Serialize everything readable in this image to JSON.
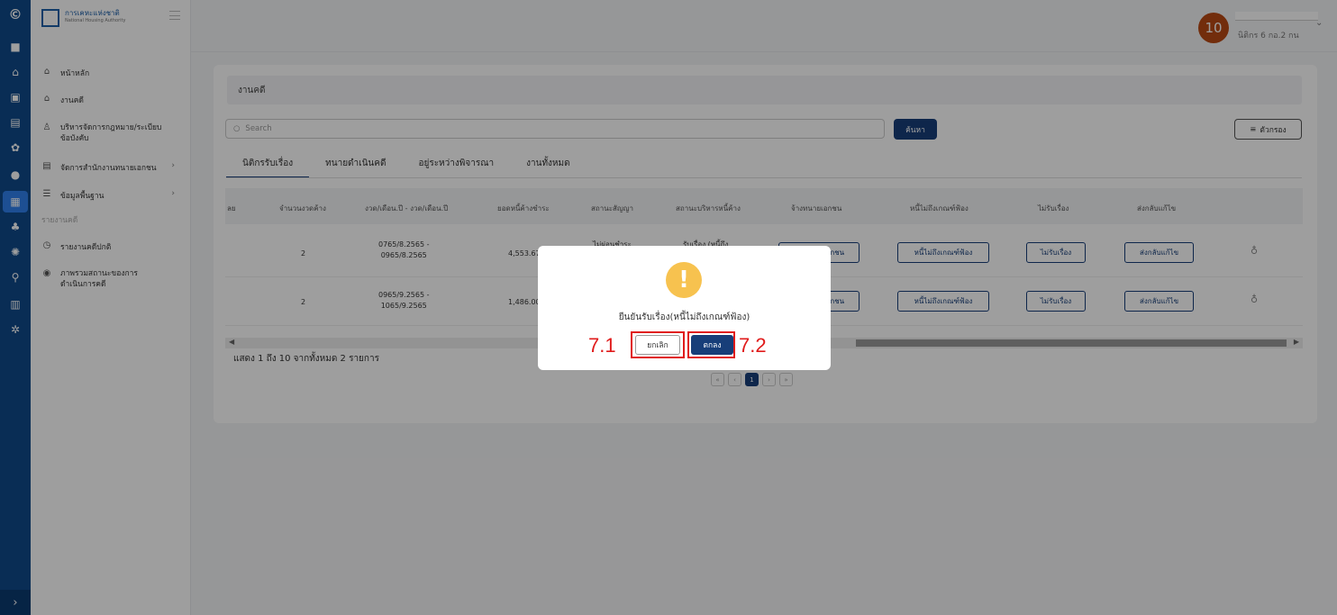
{
  "rail": {
    "icons": [
      "brand-logo-icon",
      "briefcase-icon",
      "home-icon",
      "layers-icon",
      "document-icon",
      "gear-icon",
      "user-icon",
      "dashboard-icon",
      "users-icon",
      "settings-icon",
      "search-icon",
      "chart-icon",
      "tools-icon"
    ],
    "expand": "›"
  },
  "sidebar": {
    "logo_title": "การเคหะแห่งชาติ",
    "logo_subtitle": "National Housing Authority",
    "items": [
      {
        "label": "หน้าหลัก"
      },
      {
        "label": "งานคดี"
      },
      {
        "label": "บริหารจัดการกฎหมาย/ระเบียบ ข้อบังคับ"
      },
      {
        "label": "จัดการสำนักงานทนายเอกชน"
      },
      {
        "label": "ข้อมูลพื้นฐาน"
      }
    ],
    "section": "รายงานคดี",
    "report_items": [
      {
        "label": "รายงานคดีปกติ"
      },
      {
        "label": "ภาพรวมสถานะของการ ดำเนินการคดี"
      }
    ]
  },
  "header": {
    "avatar": "10",
    "role": "นิติกร 6 กอ.2 กน"
  },
  "page": {
    "title": "งานคดี",
    "search_placeholder": "Search",
    "search_button": "ค้นหา",
    "filter_button": "ตัวกรอง",
    "tabs": [
      "นิติกรรับเรื่อง",
      "ทนายดำเนินคดี",
      "อยู่ระหว่างพิจารณา",
      "งานทั้งหมด"
    ],
    "columns": [
      "ลย",
      "จำนวนงวดค้าง",
      "งวด/เดือน.ปี - งวด/เดือน.ปี",
      "ยอดหนี้ค้างชำระ",
      "สถานะสัญญา",
      "สถานะบริหารหนี้ค้าง",
      "จ้างทนายเอกชน",
      "หนี้ไม่ถึงเกณฑ์ฟ้อง",
      "ไม่รับเรื่อง",
      "ส่งกลับแก้ไข"
    ],
    "rows": [
      {
        "installments": "2",
        "period_1": "0765/8.2565 -",
        "period_2": "0965/8.2565",
        "debt": "4,553.67",
        "contract": "ไม่ผ่อนชำระ",
        "debt_status": "รับเรื่อง (หนี้ถึง"
      },
      {
        "installments": "2",
        "period_1": "0965/9.2565 -",
        "period_2": "1065/9.2565",
        "debt": "1,486.00",
        "contract": "",
        "debt_status": ""
      }
    ],
    "row_buttons": {
      "hire": "จ้างทนายเอกชน",
      "below": "หนี้ไม่ถึงเกณฑ์ฟ้อง",
      "reject": "ไม่รับเรื่อง",
      "return": "ส่งกลับแก้ไข"
    },
    "summary": "แสดง 1 ถึง 10 จากทั้งหมด 2 รายการ",
    "pager": {
      "prev2": "«",
      "prev": "‹",
      "current": "1",
      "next": "›",
      "next2": "»"
    }
  },
  "modal": {
    "icon": "!",
    "message": "ยืนยันรับเรื่อง(หนี้ไม่ถึงเกณฑ์ฟ้อง)",
    "cancel": "ยกเลิก",
    "ok": "ตกลง"
  },
  "annotations": {
    "cancel": "7.1",
    "ok": "7.2",
    "color": "#e01b1b"
  },
  "colors": {
    "primary": "#173e79",
    "rail": "#0f4a8a",
    "avatar": "#b84a14",
    "warning": "#f7c24f"
  }
}
